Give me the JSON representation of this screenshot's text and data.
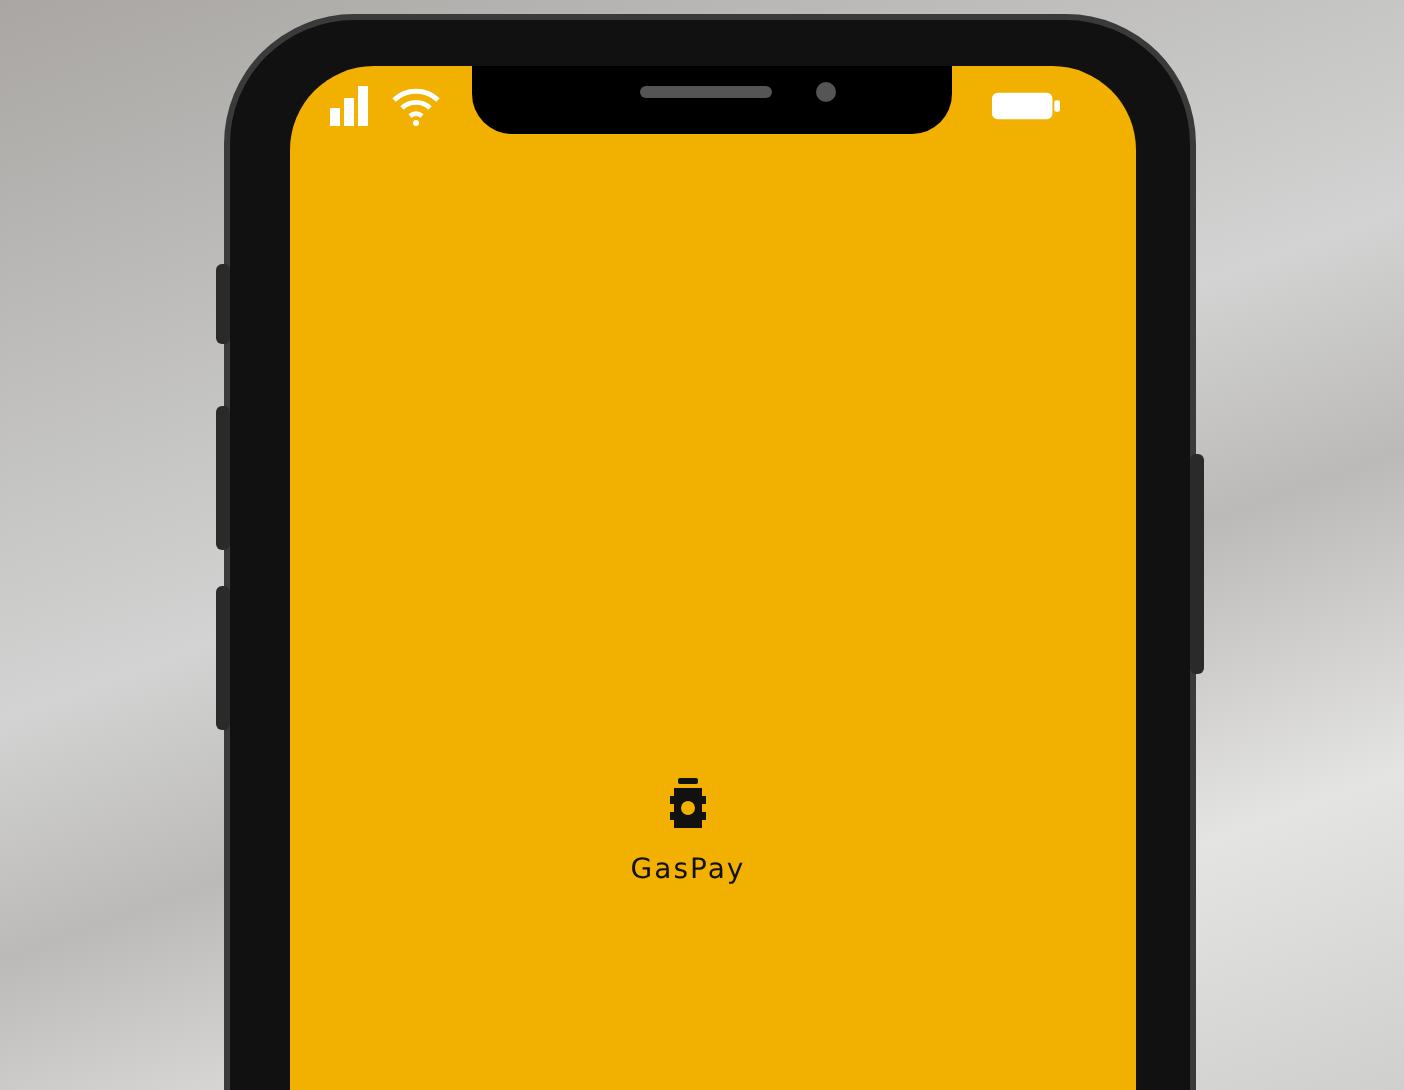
{
  "app": {
    "name": "GasPay"
  }
}
